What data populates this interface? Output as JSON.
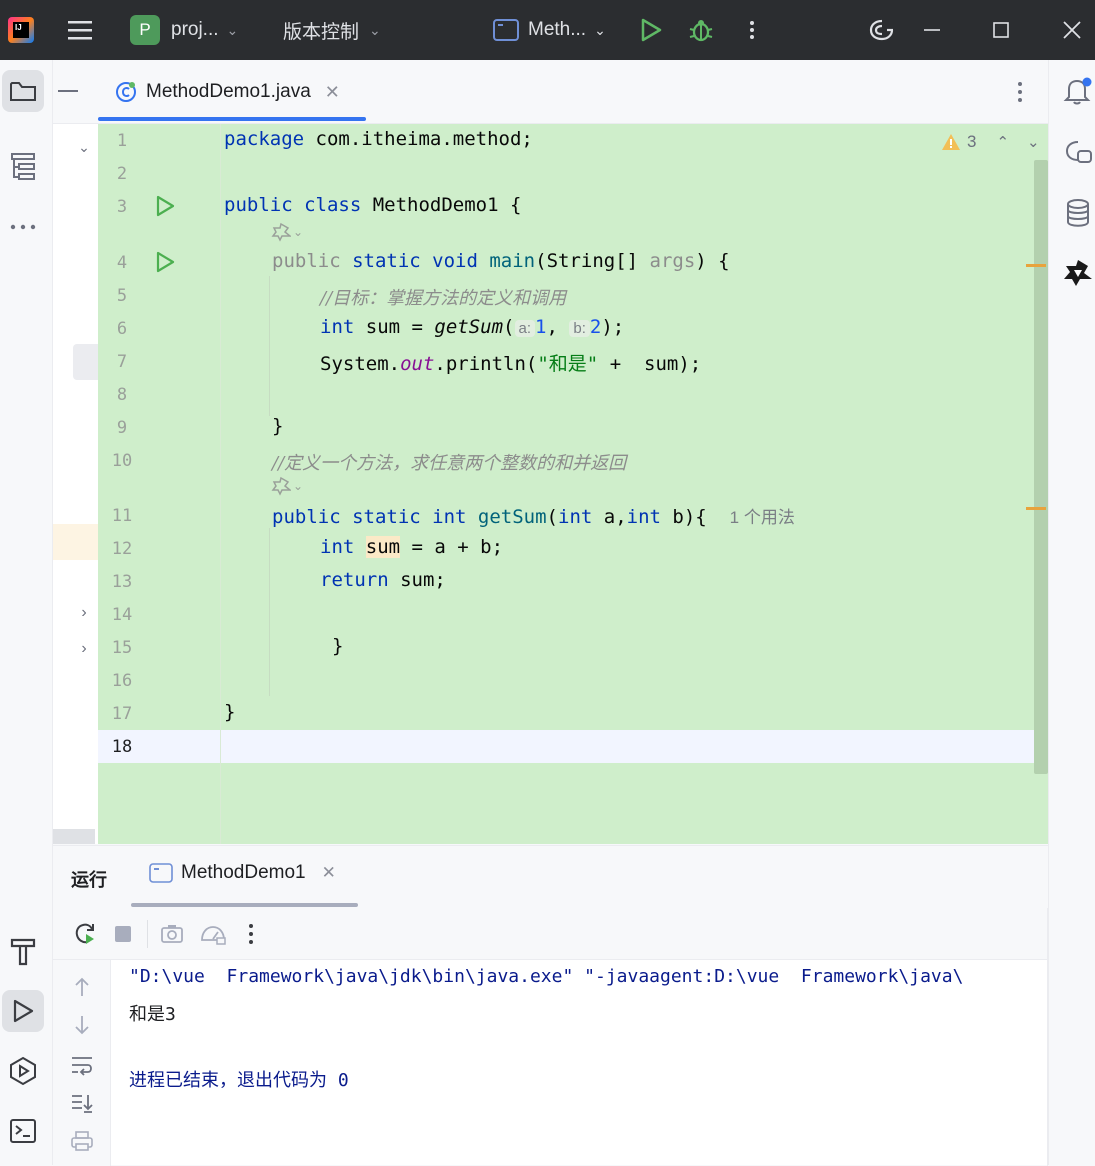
{
  "titlebar": {
    "project_badge": "P",
    "project_name": "proj...",
    "vcs_label": "版本控制",
    "run_config": "Meth...",
    "logo": "IJ"
  },
  "editor_tab": {
    "label": "MethodDemo1.java"
  },
  "warnings": {
    "count": "3"
  },
  "gutter": [
    "1",
    "2",
    "3",
    "4",
    "5",
    "6",
    "7",
    "8",
    "9",
    "10",
    "11",
    "12",
    "13",
    "14",
    "15",
    "16",
    "17",
    "18"
  ],
  "code": {
    "l1_kw": "package",
    "l1_rest": " com.itheima.method;",
    "l3_kw": "public class",
    "l3_rest": " MethodDemo1 {",
    "l4_kw1": "public",
    "l4_kw2": " static void",
    "l4_fn": " main",
    "l4_a": "(String[] ",
    "l4_param": "args",
    "l4_b": ") {",
    "l5_comment": "//目标：掌握方法的定义和调用",
    "l6_kw": "int",
    "l6_a": " sum = ",
    "l6_call": "getSum",
    "l6_b": "(",
    "l6_hint1": "a:",
    "l6_n1": "1",
    "l6_c": ", ",
    "l6_hint2": "b:",
    "l6_n2": "2",
    "l6_d": ");",
    "l7_a": "System.",
    "l7_out": "out",
    "l7_b": ".println(",
    "l7_str": "\"和是\"",
    "l7_c": " +  sum);",
    "l9": "}",
    "l10_comment": "//定义一个方法，求任意两个整数的和并返回",
    "l11_kw": "public static int",
    "l11_fn": " getSum",
    "l11_a": "(",
    "l11_kw2": "int",
    "l11_b": " a,",
    "l11_kw3": "int",
    "l11_c": " b){",
    "l11_usage": "1 个用法",
    "l12_kw": "int",
    "l12_var": "sum",
    "l12_rest": " = a + b;",
    "l13_kw": "return",
    "l13_rest": " sum;",
    "l15": "}",
    "l17": "}"
  },
  "run": {
    "title": "运行",
    "tab_label": "MethodDemo1",
    "line1": "\"D:\\vue  Framework\\java\\jdk\\bin\\java.exe\" \"-javaagent:D:\\vue  Framework\\java\\",
    "line2": "和是3",
    "line3": "进程已结束，退出代码为 0"
  },
  "colors": {
    "accent": "#3574f0",
    "green_bg": "#cfeecb",
    "keyword": "#0033b3",
    "run_green": "#4caf50"
  }
}
